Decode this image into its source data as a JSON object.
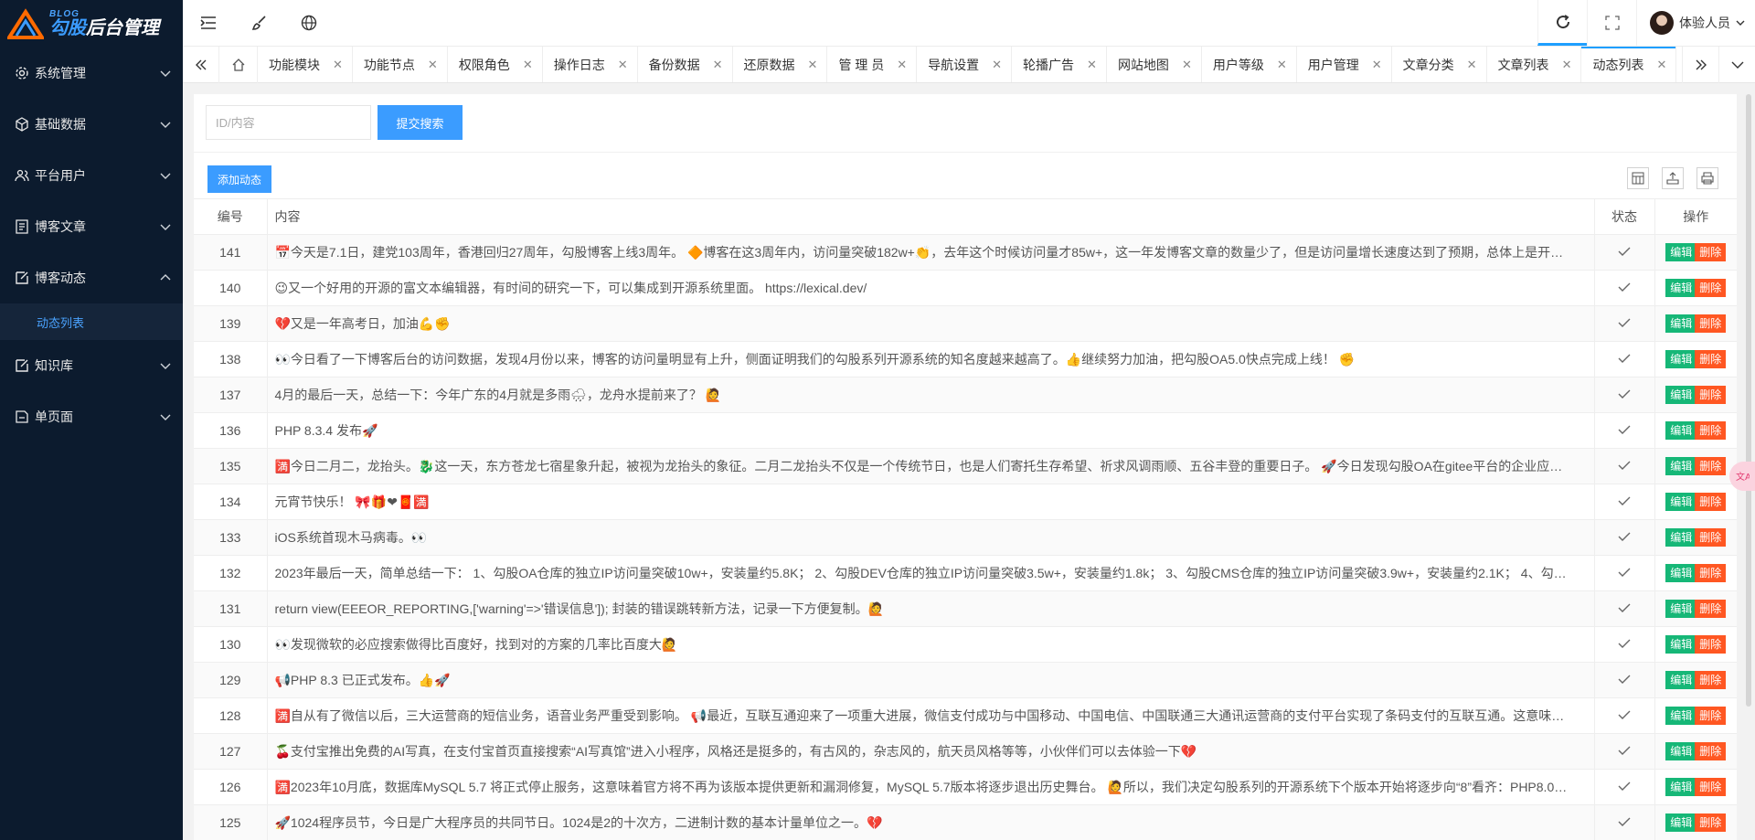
{
  "logo": {
    "blog": "BLOG",
    "title_a": "勾股",
    "title_b": "后台管理"
  },
  "sidebar": {
    "items": [
      {
        "label": "系统管理",
        "icon": "gear-icon"
      },
      {
        "label": "基础数据",
        "icon": "cube-icon"
      },
      {
        "label": "平台用户",
        "icon": "users-icon"
      },
      {
        "label": "博客文章",
        "icon": "document-icon"
      },
      {
        "label": "博客动态",
        "icon": "edit-icon",
        "expanded": true
      },
      {
        "label": "知识库",
        "icon": "edit-icon"
      },
      {
        "label": "单页面",
        "icon": "page-icon"
      }
    ],
    "submenu": {
      "label": "动态列表"
    }
  },
  "header": {
    "user_name": "体验人员"
  },
  "tabs": [
    "功能模块",
    "功能节点",
    "权限角色",
    "操作日志",
    "备份数据",
    "还原数据",
    "管 理 员",
    "导航设置",
    "轮播广告",
    "网站地图",
    "用户等级",
    "用户管理",
    "文章分类",
    "文章列表",
    "动态列表"
  ],
  "search": {
    "placeholder": "ID/内容",
    "submit_label": "提交搜索"
  },
  "toolbar": {
    "add_label": "添加动态"
  },
  "table": {
    "headers": {
      "id": "编号",
      "content": "内容",
      "status": "状态",
      "op": "操作"
    },
    "edit_label": "编辑",
    "delete_label": "删除",
    "rows": [
      {
        "id": "141",
        "content": "📅今天是7.1日，建党103周年，香港回归27周年，勾股博客上线3周年。 🔶博客在这3周年内，访问量突破182w+👏，去年这个时候访问量才85w+，这一年发博客文章的数量少了，但是访问量增长速度达到了预期，总体上是开…"
      },
      {
        "id": "140",
        "content": "😉又一个好用的开源的富文本编辑器，有时间的研究一下，可以集成到开源系统里面。 https://lexical.dev/"
      },
      {
        "id": "139",
        "content": "💔又是一年高考日，加油💪✊"
      },
      {
        "id": "138",
        "content": "👀今日看了一下博客后台的访问数据，发现4月份以来，博客的访问量明显有上升，侧面证明我们的勾股系列开源系统的知名度越来越高了。👍继续努力加油，把勾股OA5.0快点完成上线！ ✊"
      },
      {
        "id": "137",
        "content": "4月的最后一天，总结一下：今年广东的4月就是多雨🌧，龙舟水提前来了？ 🙋"
      },
      {
        "id": "136",
        "content": "PHP 8.3.4 发布🚀"
      },
      {
        "id": "135",
        "content": "🈵今日二月二，龙抬头。🐉这一天，东方苍龙七宿星象升起，被视为龙抬头的象征。二月二龙抬头不仅是一个传统节日，也是人们寄托生存希望、祈求风调雨顺、五谷丰登的重要日子。 🚀今日发现勾股OA在gitee平台的企业应…"
      },
      {
        "id": "134",
        "content": "元宵节快乐！ 🎀🎁❤🧧🈵"
      },
      {
        "id": "133",
        "content": "iOS系统首现木马病毒。👀"
      },
      {
        "id": "132",
        "content": "2023年最后一天，简单总结一下： 1、勾股OA仓库的独立IP访问量突破10w+，安装量约5.8K； 2、勾股DEV仓库的独立IP访问量突破3.5w+，安装量约1.8k； 3、勾股CMS仓库的独立IP访问量突破3.9w+，安装量约2.1K； 4、勾…"
      },
      {
        "id": "131",
        "content": "return view(EEEOR_REPORTING,['warning'=>'错误信息']); 封装的错误跳转新方法，记录一下方便复制。🙋"
      },
      {
        "id": "130",
        "content": "👀发现微软的必应搜索做得比百度好，找到对的方案的几率比百度大🙋"
      },
      {
        "id": "129",
        "content": "📢PHP 8.3 已正式发布。👍🚀"
      },
      {
        "id": "128",
        "content": "🈵自从有了微信以后，三大运营商的短信业务，语音业务严重受到影响。 📢最近，互联互通迎来了一项重大进展，微信支付成功与中国移动、中国电信、中国联通三大通讯运营商的支付平台实现了条码支付的互联互通。这意味…"
      },
      {
        "id": "127",
        "content": "🍒支付宝推出免费的AI写真，在支付宝首页直接搜索“AI写真馆”进入小程序，风格还是挺多的，有古风的，杂志风的，航天员风格等等，小伙伴们可以去体验一下💔"
      },
      {
        "id": "126",
        "content": "🈵2023年10月底，数据库MySQL 5.7 将正式停止服务，这意味着官方将不再为该版本提供更新和漏洞修复，MySQL 5.7版本将逐步退出历史舞台。 🙋所以，我们决定勾股系列的开源系统下个版本开始将逐步向“8”看齐：PHP8.0…"
      },
      {
        "id": "125",
        "content": "🚀1024程序员节，今日是广大程序员的共同节日。1024是2的十次方，二进制计数的基本计量单位之一。💔"
      }
    ]
  },
  "colors": {
    "sidebar_bg": "#0c1b2e",
    "accent": "#3b9cff",
    "edit": "#16b777",
    "delete": "#ff5722"
  }
}
